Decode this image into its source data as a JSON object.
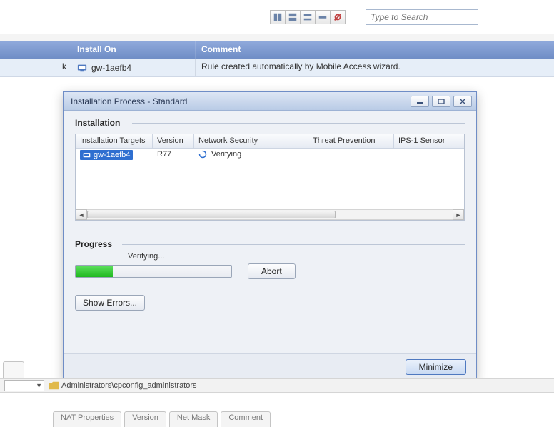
{
  "search": {
    "placeholder": "Type to Search"
  },
  "grid": {
    "headers": {
      "install_on": "Install On",
      "comment": "Comment"
    },
    "row0": {
      "blank_suffix": "k",
      "install_on": "gw-1aefb4",
      "comment": "Rule created automatically by Mobile Access wizard."
    }
  },
  "dialog": {
    "title": "Installation Process  - Standard",
    "section_installation": "Installation",
    "table": {
      "head": {
        "targets": "Installation Targets",
        "version": "Version",
        "network": "Network Security",
        "threat": "Threat Prevention",
        "ips": "IPS-1 Sensor"
      },
      "row0": {
        "target": "gw-1aefb4",
        "version": "R77",
        "network": "Verifying"
      }
    },
    "section_progress": "Progress",
    "progress_label": "Verifying...",
    "abort": "Abort",
    "show_errors": "Show Errors...",
    "minimize": "Minimize"
  },
  "pathbar": {
    "text": "Administrators\\cpconfig_administrators"
  },
  "bottom_tabs": {
    "t1": "NAT Properties",
    "t2": "Version",
    "t3": "Net Mask",
    "t4": "Comment"
  }
}
